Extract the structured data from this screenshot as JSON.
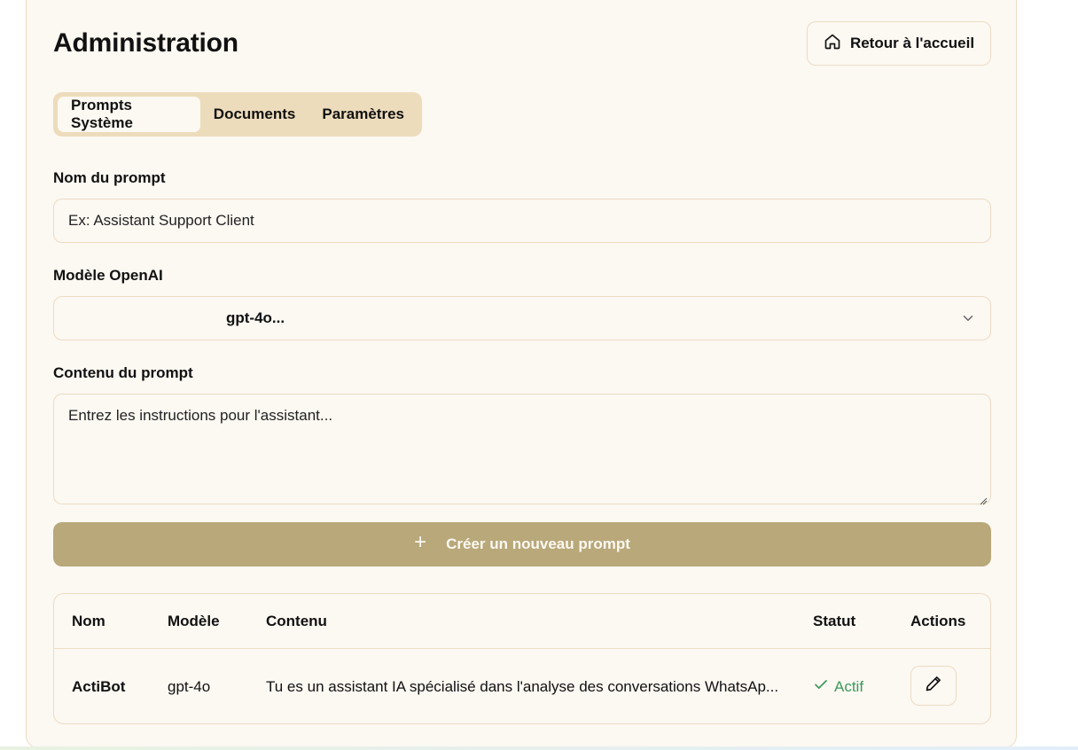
{
  "header": {
    "title": "Administration",
    "home_button": "Retour à l'accueil",
    "home_icon": "home-icon"
  },
  "tabs": [
    {
      "label": "Prompts Système",
      "active": true
    },
    {
      "label": "Documents",
      "active": false
    },
    {
      "label": "Paramètres",
      "active": false
    }
  ],
  "form": {
    "name_label": "Nom du prompt",
    "name_placeholder": "Ex: Assistant Support Client",
    "model_label": "Modèle OpenAI",
    "model_value": "gpt-4o...",
    "content_label": "Contenu du prompt",
    "content_placeholder": "Entrez les instructions pour l'assistant...",
    "create_button": "Créer un nouveau prompt",
    "create_icon": "plus-icon"
  },
  "table": {
    "columns": [
      "Nom",
      "Modèle",
      "Contenu",
      "Statut",
      "Actions"
    ],
    "rows": [
      {
        "name": "ActiBot",
        "model": "gpt-4o",
        "content": "Tu es un assistant IA spécialisé dans l'analyse des conversations WhatsAp...",
        "status": "Actif",
        "status_icon": "check-icon",
        "action_icon": "pencil-icon"
      }
    ]
  },
  "colors": {
    "background": "#fcf8f2",
    "border": "#ecdcc4",
    "tabs_bg": "#eddcbc",
    "button_bg": "#b8a87a",
    "status_green": "#3a9a5b"
  }
}
